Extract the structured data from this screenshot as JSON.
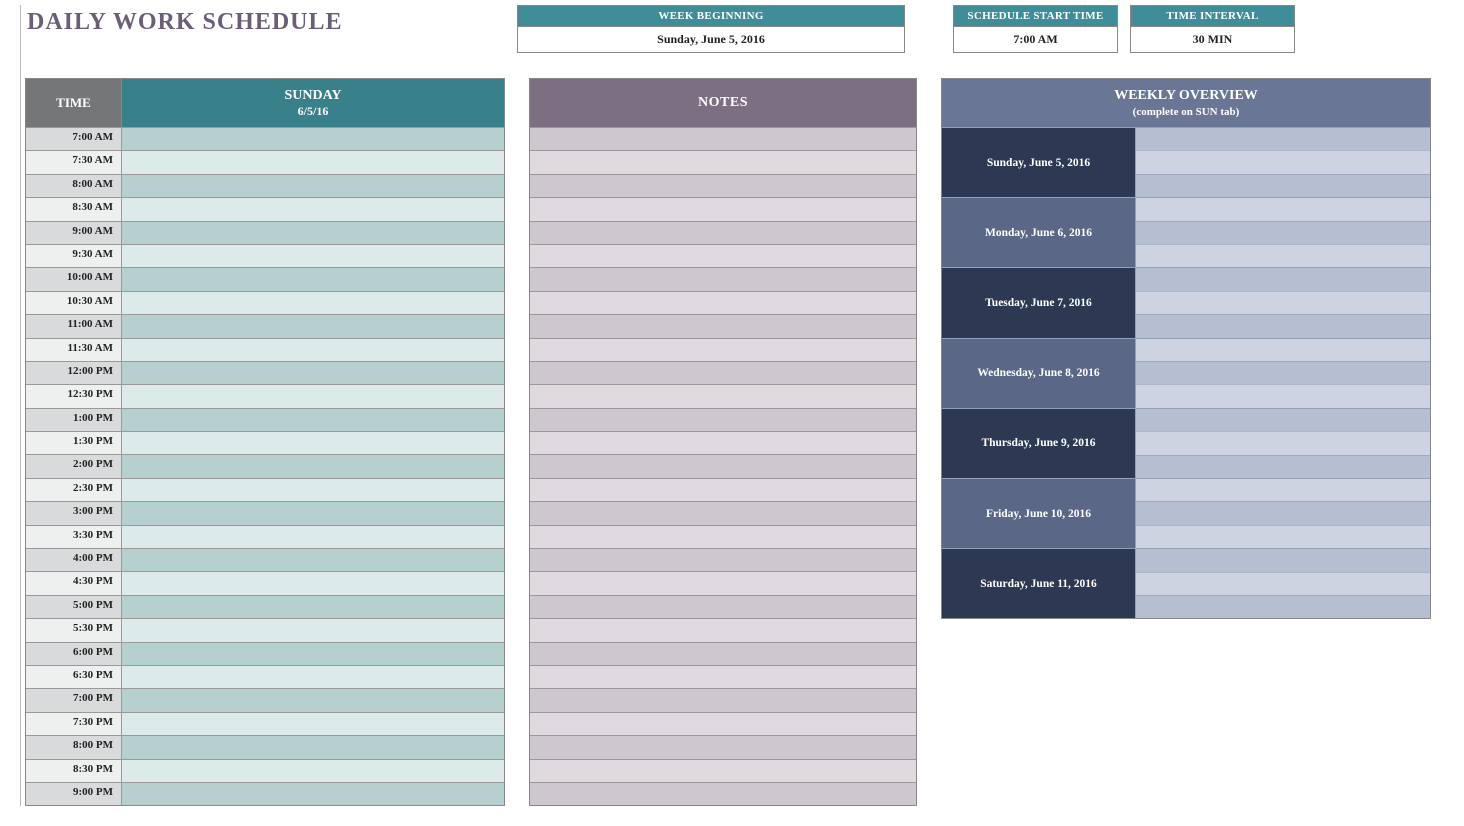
{
  "title": "DAILY WORK SCHEDULE",
  "info": {
    "week_lbl": "WEEK BEGINNING",
    "week_val": "Sunday, June 5, 2016",
    "start_lbl": "SCHEDULE START TIME",
    "start_val": "7:00 AM",
    "int_lbl": "TIME INTERVAL",
    "int_val": "30 MIN"
  },
  "schedule": {
    "time_hdr": "TIME",
    "day_name": "SUNDAY",
    "day_date": "6/5/16",
    "rows": [
      {
        "t": "7:00 AM",
        "hr": true,
        "v": ""
      },
      {
        "t": "7:30 AM",
        "hr": false,
        "v": ""
      },
      {
        "t": "8:00 AM",
        "hr": true,
        "v": ""
      },
      {
        "t": "8:30 AM",
        "hr": false,
        "v": ""
      },
      {
        "t": "9:00 AM",
        "hr": true,
        "v": ""
      },
      {
        "t": "9:30 AM",
        "hr": false,
        "v": ""
      },
      {
        "t": "10:00 AM",
        "hr": true,
        "v": ""
      },
      {
        "t": "10:30 AM",
        "hr": false,
        "v": ""
      },
      {
        "t": "11:00 AM",
        "hr": true,
        "v": ""
      },
      {
        "t": "11:30 AM",
        "hr": false,
        "v": ""
      },
      {
        "t": "12:00 PM",
        "hr": true,
        "v": ""
      },
      {
        "t": "12:30 PM",
        "hr": false,
        "v": ""
      },
      {
        "t": "1:00 PM",
        "hr": true,
        "v": ""
      },
      {
        "t": "1:30 PM",
        "hr": false,
        "v": ""
      },
      {
        "t": "2:00 PM",
        "hr": true,
        "v": ""
      },
      {
        "t": "2:30 PM",
        "hr": false,
        "v": ""
      },
      {
        "t": "3:00 PM",
        "hr": true,
        "v": ""
      },
      {
        "t": "3:30 PM",
        "hr": false,
        "v": ""
      },
      {
        "t": "4:00 PM",
        "hr": true,
        "v": ""
      },
      {
        "t": "4:30 PM",
        "hr": false,
        "v": ""
      },
      {
        "t": "5:00 PM",
        "hr": true,
        "v": ""
      },
      {
        "t": "5:30 PM",
        "hr": false,
        "v": ""
      },
      {
        "t": "6:00 PM",
        "hr": true,
        "v": ""
      },
      {
        "t": "6:30 PM",
        "hr": false,
        "v": ""
      },
      {
        "t": "7:00 PM",
        "hr": true,
        "v": ""
      },
      {
        "t": "7:30 PM",
        "hr": false,
        "v": ""
      },
      {
        "t": "8:00 PM",
        "hr": true,
        "v": ""
      },
      {
        "t": "8:30 PM",
        "hr": false,
        "v": ""
      },
      {
        "t": "9:00 PM",
        "hr": true,
        "v": ""
      }
    ]
  },
  "notes": {
    "hdr": "NOTES",
    "rows": 29
  },
  "weekly": {
    "hdr": "WEEKLY OVERVIEW",
    "sub": "(complete on SUN tab)",
    "days": [
      {
        "d": "Sunday, June 5, 2016"
      },
      {
        "d": "Monday, June 6, 2016"
      },
      {
        "d": "Tuesday, June 7, 2016"
      },
      {
        "d": "Wednesday, June 8, 2016"
      },
      {
        "d": "Thursday, June 9, 2016"
      },
      {
        "d": "Friday, June 10, 2016"
      },
      {
        "d": "Saturday, June 11, 2016"
      }
    ]
  }
}
